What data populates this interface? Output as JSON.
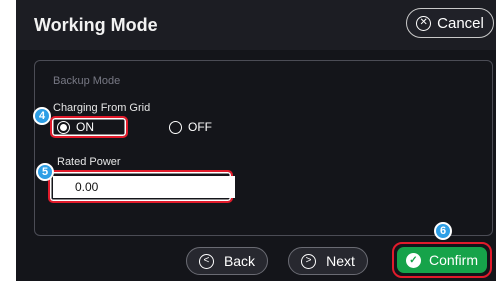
{
  "header": {
    "title": "Working Mode",
    "cancel_label": "Cancel"
  },
  "panel": {
    "section_label": "Backup Mode",
    "charging_label": "Charging From Grid",
    "options": [
      {
        "label": "ON",
        "checked": true
      },
      {
        "label": "OFF",
        "checked": false
      }
    ],
    "rated_power_label": "Rated Power",
    "rated_power_value": "0.00",
    "rated_power_unit": "%"
  },
  "footer": {
    "back_label": "Back",
    "next_label": "Next",
    "confirm_label": "Confirm"
  },
  "badges": {
    "b4": "4",
    "b5": "5",
    "b6": "6"
  },
  "colors": {
    "background": "#14151a",
    "highlight": "#e21b2b",
    "badge": "#2e9fe6",
    "confirm": "#16a34a"
  }
}
